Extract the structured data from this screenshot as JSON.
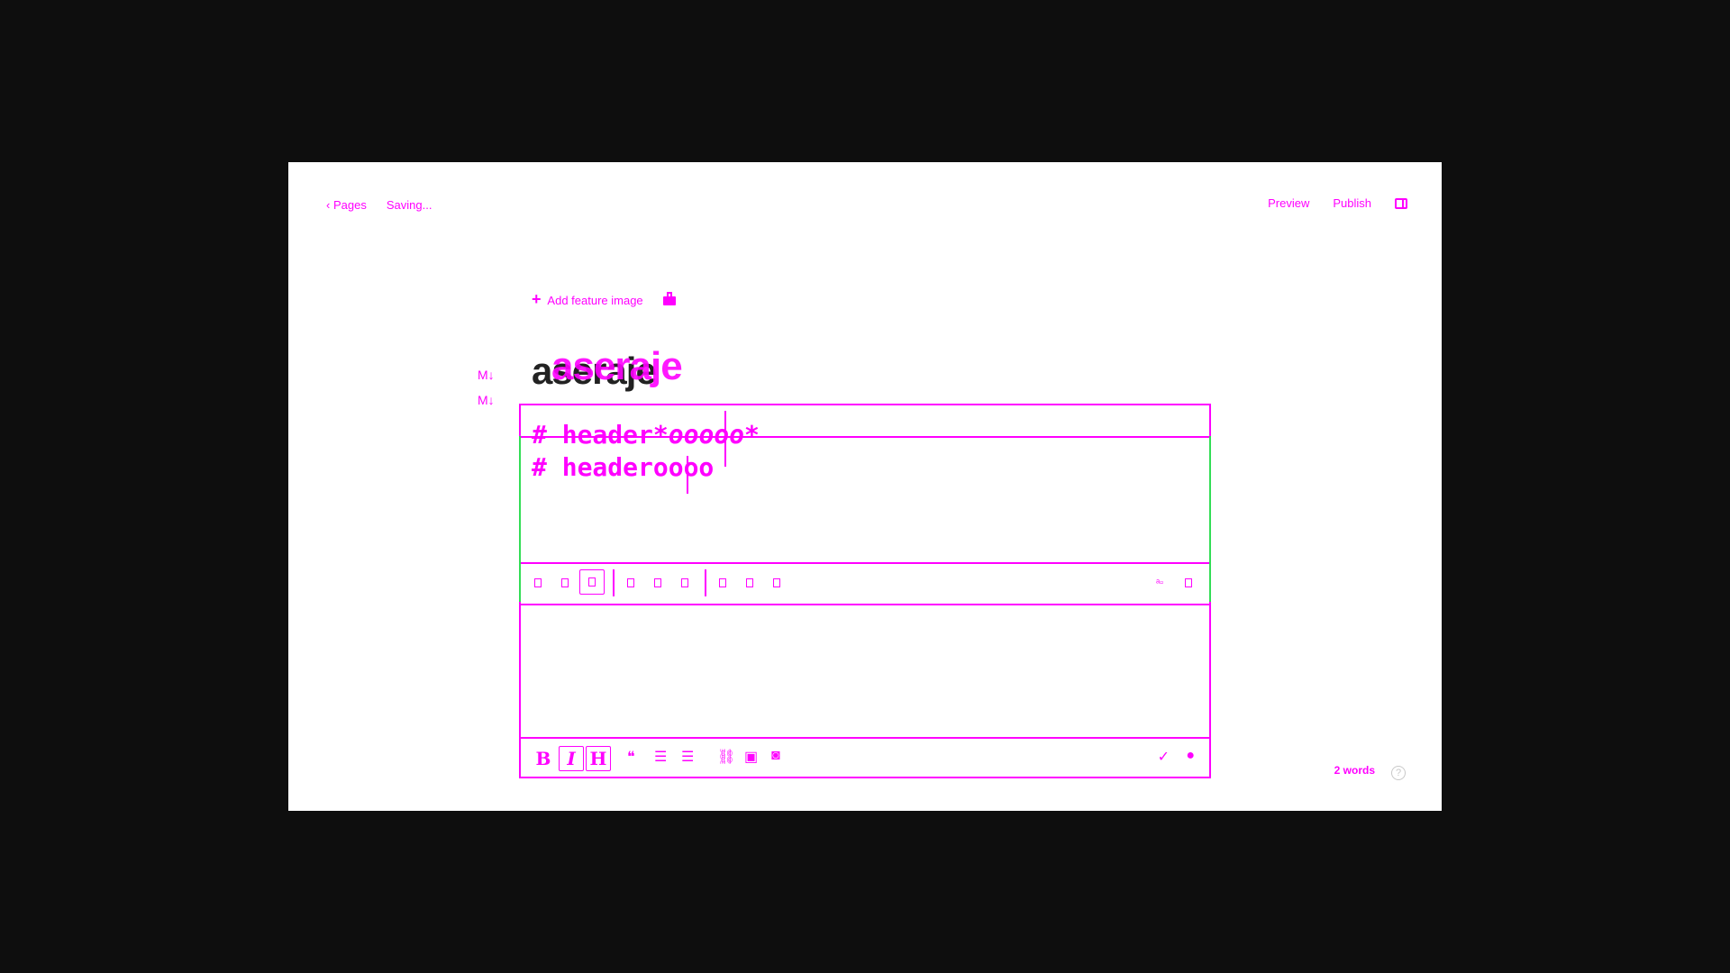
{
  "nav": {
    "back_chevron": "‹",
    "back_label": "Pages",
    "status": "Saving...",
    "preview_label": "Preview",
    "publish_label": "Publish"
  },
  "feature": {
    "add_label": "Add feature image"
  },
  "post": {
    "title": "aseraje"
  },
  "markdown_badge": "M↓",
  "editor": {
    "line1_prefix": "# ",
    "line1_text": "header",
    "line1_emph_open": "*",
    "line1_emph": "ooooo",
    "line1_emph_close": "*",
    "line2_prefix": "# ",
    "line2_text": "headeroooo"
  },
  "toolbar_bottom": {
    "bold": "B",
    "italic": "I",
    "heading": "H"
  },
  "footer": {
    "word_count": "2 words",
    "help": "?"
  },
  "colors": {
    "background": "#0e0e0e",
    "accent": "#ff00ff",
    "focus": "#33dd55"
  }
}
